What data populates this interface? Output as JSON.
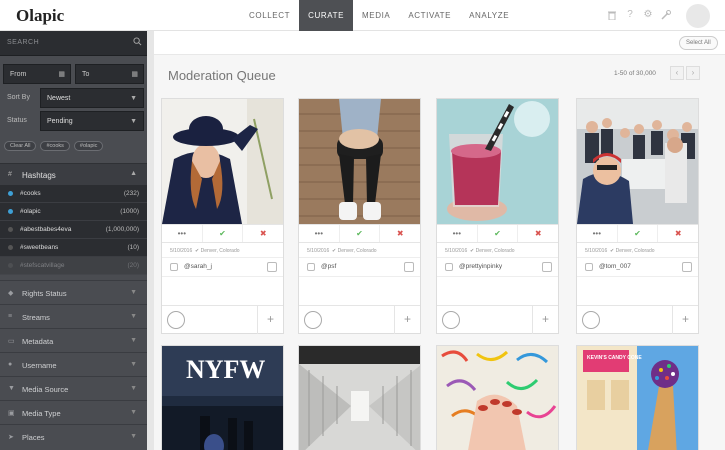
{
  "app": {
    "logo": "Olapic"
  },
  "nav": {
    "tabs": [
      {
        "label": "COLLECT"
      },
      {
        "label": "CURATE",
        "active": true
      },
      {
        "label": "MEDIA"
      },
      {
        "label": "ACTIVATE"
      },
      {
        "label": "ANALYZE"
      }
    ]
  },
  "sidebar": {
    "search_placeholder": "SEARCH",
    "from_label": "From",
    "to_label": "To",
    "sort_label": "Sort By",
    "sort_value": "Newest",
    "status_label": "Status",
    "status_value": "Pending",
    "clear_label": "Clear All",
    "chips": [
      "#cooks",
      "#olapic"
    ],
    "hashtags_title": "Hashtags",
    "hashtags": [
      {
        "name": "#cooks",
        "count": "(232)",
        "on": true
      },
      {
        "name": "#olapic",
        "count": "(1000)",
        "on": true
      },
      {
        "name": "#abestbabes4eva",
        "count": "(1,000,000)",
        "on": false
      },
      {
        "name": "#sweetbeans",
        "count": "(10)",
        "on": false
      },
      {
        "name": "#stefscatvillage",
        "count": "(20)",
        "on": false,
        "faded": true
      }
    ],
    "filters": [
      "Rights Status",
      "Streams",
      "Metadata",
      "Username",
      "Media Source",
      "Media Type",
      "Places"
    ]
  },
  "main": {
    "select_all": "Select All",
    "title": "Moderation Queue",
    "pager": "1-50 of 30,000",
    "cards": [
      {
        "date": "5/10/2016",
        "place": "Denver, Colorado",
        "user": "@sarah_j"
      },
      {
        "date": "5/10/2016",
        "place": "Denver, Colorado",
        "user": "@psf"
      },
      {
        "date": "5/10/2016",
        "place": "Denver, Colorado",
        "user": "@prettyinpinky"
      },
      {
        "date": "5/10/2016",
        "place": "Denver, Colorado",
        "user": "@tom_007"
      }
    ],
    "row2_texts": {
      "nyfw": "NYFW",
      "candy": "KEVIN'S CANDY CONE"
    }
  },
  "colors": {
    "accent": "#3ea0d6",
    "approve": "#5cb85c",
    "reject": "#d9534f",
    "sidebar": "#4a4c51"
  }
}
